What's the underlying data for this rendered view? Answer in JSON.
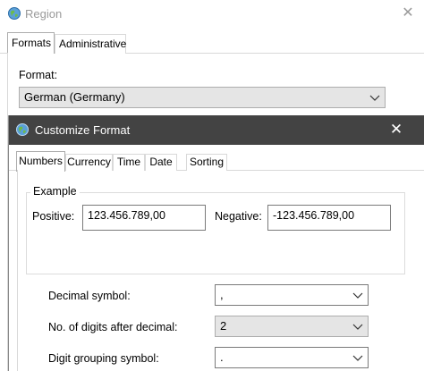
{
  "region_window": {
    "title": "Region",
    "tabs": [
      {
        "label": "Formats",
        "active": true
      },
      {
        "label": "Administrative",
        "active": false
      }
    ],
    "format_label": "Format:",
    "format_value": "German (Germany)"
  },
  "customize_window": {
    "title": "Customize Format",
    "tabs": [
      {
        "label": "Numbers",
        "active": true
      },
      {
        "label": "Currency",
        "active": false
      },
      {
        "label": "Time",
        "active": false
      },
      {
        "label": "Date",
        "active": false
      },
      {
        "label": "Sorting",
        "active": false
      }
    ],
    "example": {
      "legend": "Example",
      "positive_label": "Positive:",
      "positive_value": "123.456.789,00",
      "negative_label": "Negative:",
      "negative_value": "-123.456.789,00"
    },
    "settings": [
      {
        "label": "Decimal symbol:",
        "value": ","
      },
      {
        "label": "No. of digits after decimal:",
        "value": "2"
      },
      {
        "label": "Digit grouping symbol:",
        "value": "."
      }
    ]
  },
  "colors": {
    "dark_titlebar": "#434343",
    "inactive_title_text": "#9a9a9a",
    "readonly_combo_bg": "#e5e5e5"
  }
}
